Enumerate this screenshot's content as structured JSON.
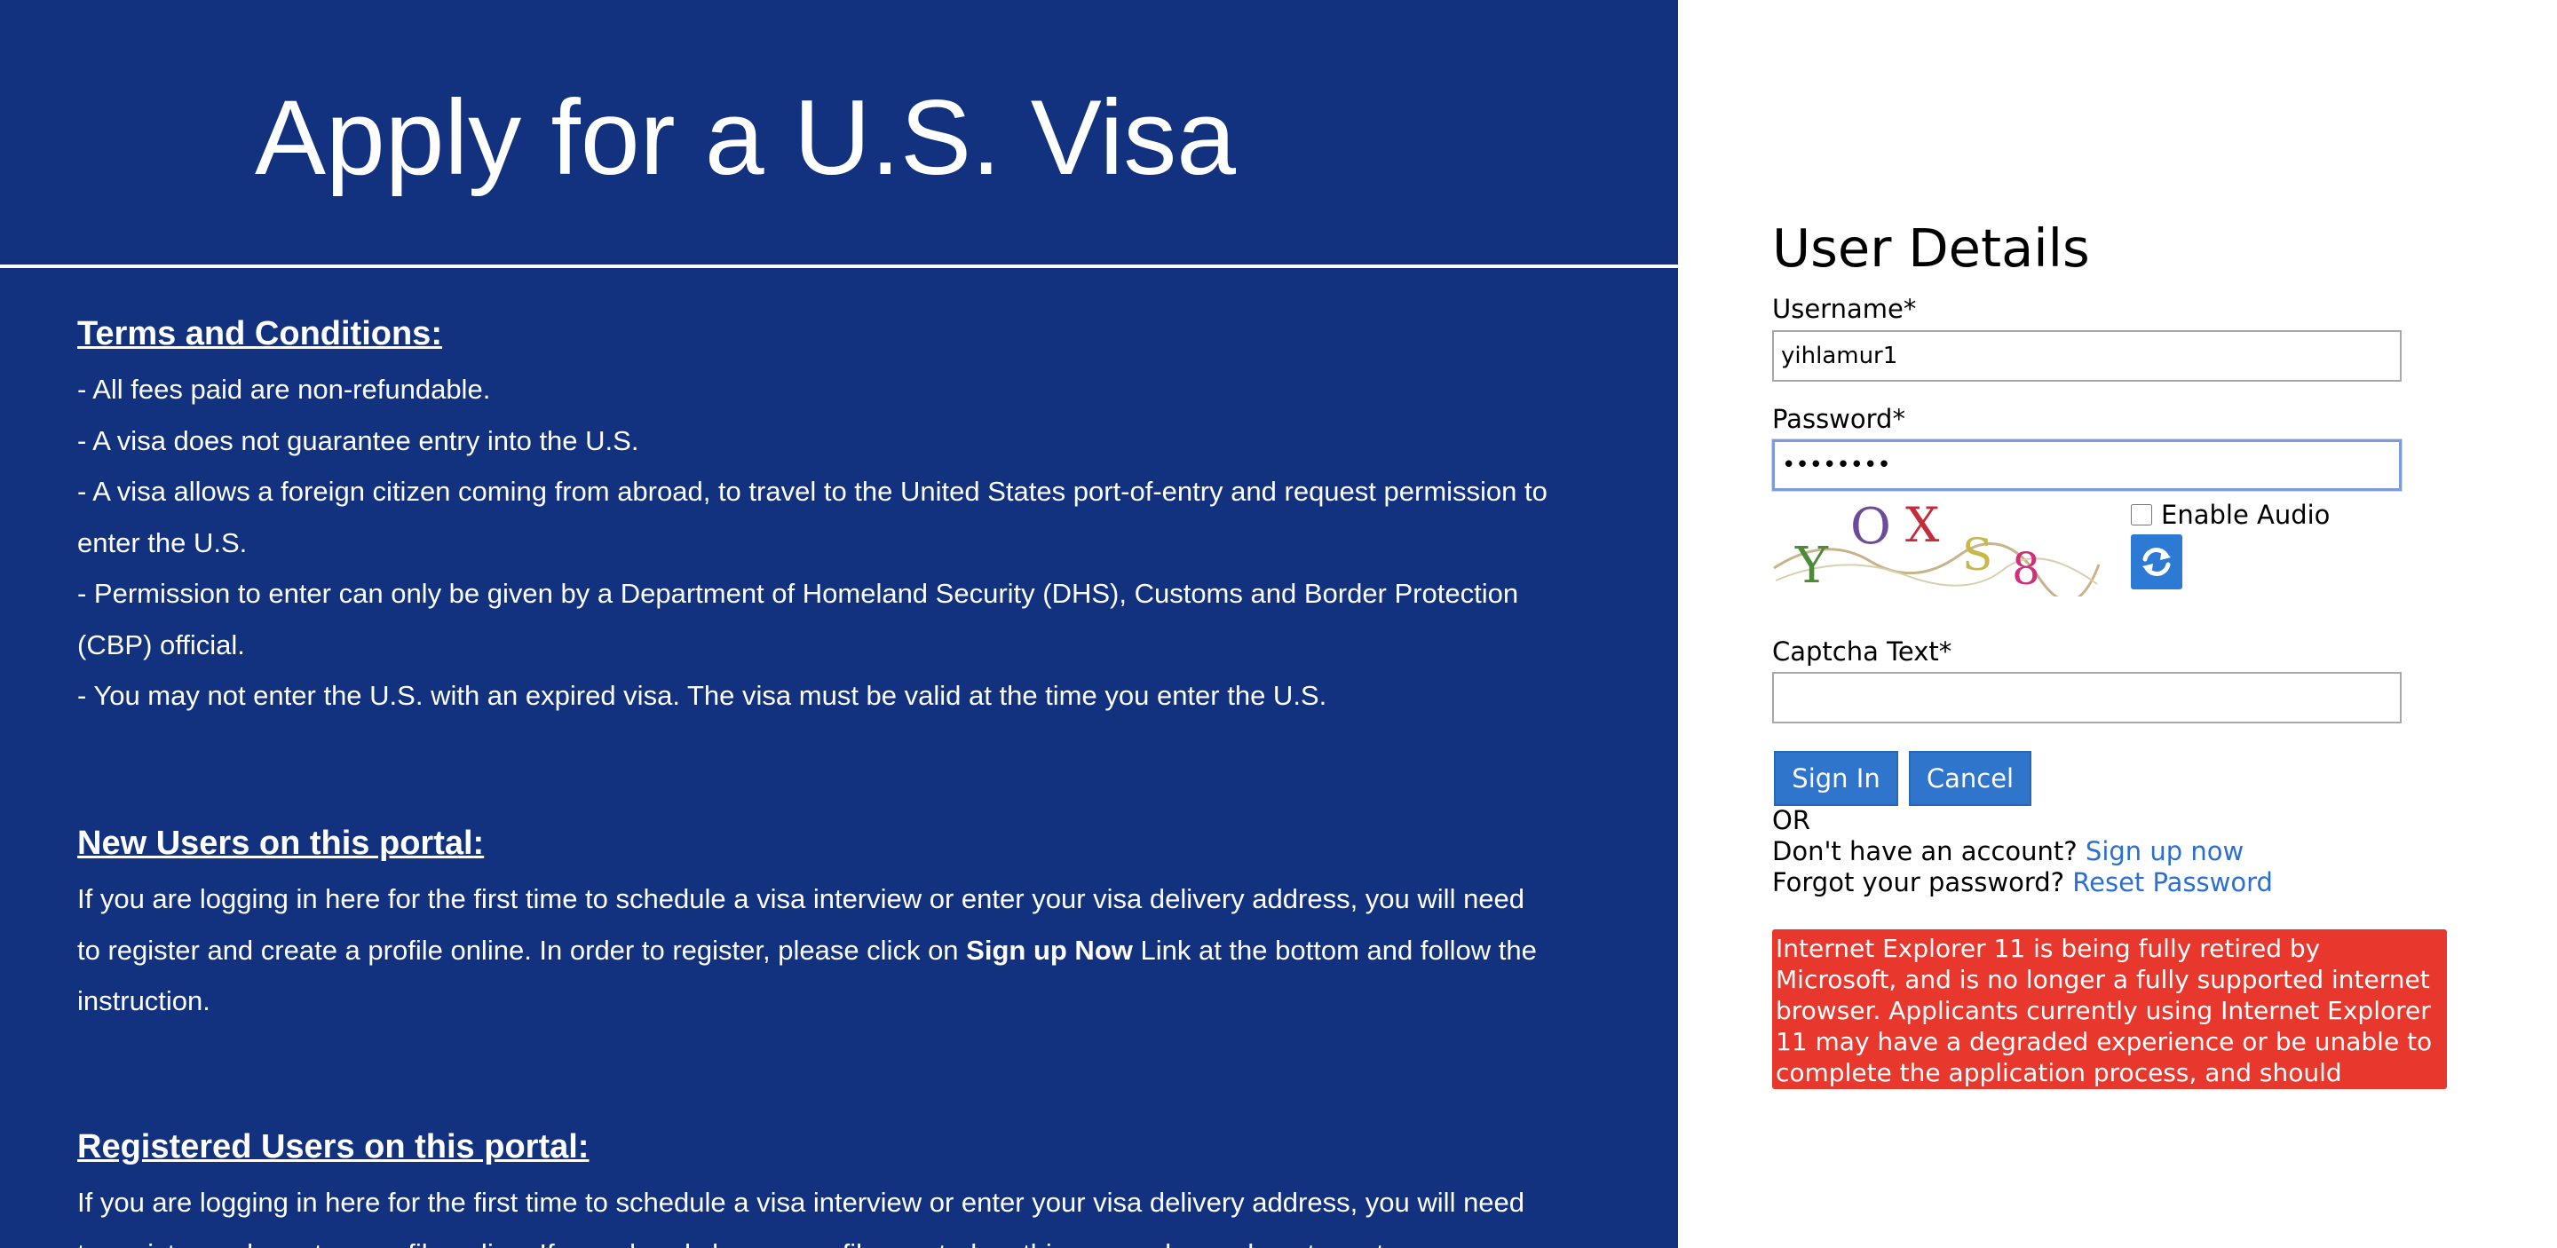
{
  "hero": {
    "title": "Apply for a U.S. Visa"
  },
  "terms": {
    "heading": "Terms and Conditions:",
    "items": [
      "- All fees paid are non-refundable.",
      "- A visa does not guarantee entry into the U.S.",
      "- A visa allows a foreign citizen coming from abroad, to travel to the United States port-of-entry and request permission to enter the U.S.",
      "- Permission to enter can only be given by a Department of Homeland Security (DHS), Customs and Border Protection (CBP) official.",
      "- You may not enter the U.S. with an expired visa. The visa must be valid at the time you enter the U.S."
    ]
  },
  "new_users": {
    "heading": "New Users on this portal:",
    "text_before": "If you are logging in here for the first time to schedule a visa interview or enter your visa delivery address, you will need to register and create a profile online. In order to register, please click on ",
    "bold": "Sign up Now",
    "text_after": " Link at the bottom and follow the instruction."
  },
  "registered_users": {
    "heading": "Registered Users on this portal:",
    "text": "If you are logging in here for the first time to schedule a visa interview or enter your visa delivery address, you will need to register and create a profile online. If you already have a profile created on this page, please do not create"
  },
  "login": {
    "title": "User Details",
    "username_label": "Username*",
    "username_value": "yihlamur1",
    "password_label": "Password*",
    "password_value": "••••••••",
    "captcha_image_text": "YOXS8",
    "enable_audio_label": "Enable Audio",
    "enable_audio_checked": false,
    "captcha_label": "Captcha Text*",
    "captcha_value": "",
    "sign_in_label": "Sign In",
    "cancel_label": "Cancel",
    "or_text": "OR",
    "no_account_text": "Don't have an account?",
    "signup_link": "Sign up now",
    "forgot_text": "Forgot your password?",
    "reset_link": "Reset Password",
    "ie_notice": "Internet Explorer 11 is being fully retired by Microsoft, and is no longer a fully supported internet browser. Applicants currently using Internet Explorer 11 may have a degraded experience or be unable to complete the application process, and should transition to Microsoft Edge."
  },
  "colors": {
    "left_panel_bg": "#12327f",
    "button_blue": "#2f75cc",
    "link_blue": "#2a6fd6",
    "alert_red": "#e8372c"
  },
  "icons": {
    "refresh": "refresh-icon"
  }
}
